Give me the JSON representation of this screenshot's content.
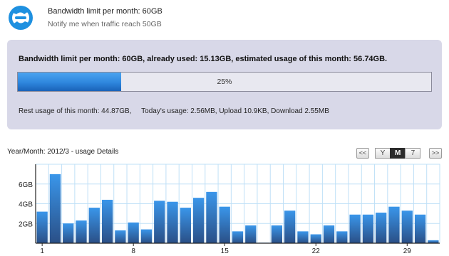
{
  "header": {
    "title": "Bandwidth limit per month: 60GB",
    "subtitle": "Notify me when traffic reach 50GB",
    "logo_icon": "swirl-logo-icon"
  },
  "usage": {
    "summary": "Bandwidth limit per month: 60GB, already used: 15.13GB, estimated usage of this month: 56.74GB.",
    "progress_label": "25%",
    "progress_fraction": 0.25,
    "rest_text": "Rest usage of this month: 44.87GB,     Today's usage: 2.56MB, Upload 10.9KB, Download 2.55MB"
  },
  "details": {
    "label": "Year/Month: 2012/3 - usage Details",
    "prev_label": "<<",
    "next_label": ">>",
    "views": [
      {
        "label": "Y",
        "active": false
      },
      {
        "label": "M",
        "active": true
      },
      {
        "label": "7",
        "active": false
      }
    ]
  },
  "colors": {
    "bar_top": "#3a96ea",
    "bar_bottom": "#2a4f86",
    "grid": "#bfe0f7",
    "axis": "#222222"
  },
  "chart_data": {
    "type": "bar",
    "x": [
      1,
      2,
      3,
      4,
      5,
      6,
      7,
      8,
      9,
      10,
      11,
      12,
      13,
      14,
      15,
      16,
      17,
      18,
      19,
      20,
      21,
      22,
      23,
      24,
      25,
      26,
      27,
      28,
      29,
      30,
      31
    ],
    "values": [
      3.2,
      7.0,
      2.0,
      2.3,
      3.6,
      4.4,
      1.3,
      2.1,
      1.4,
      4.3,
      4.2,
      3.6,
      4.6,
      5.2,
      3.7,
      1.2,
      1.8,
      0.05,
      1.8,
      3.3,
      1.2,
      0.9,
      1.8,
      1.2,
      2.9,
      2.9,
      3.1,
      3.7,
      3.3,
      2.9,
      0.3
    ],
    "x_tick_labels": [
      "1",
      "8",
      "15",
      "22",
      "29"
    ],
    "x_tick_values": [
      1,
      8,
      15,
      22,
      29
    ],
    "y_tick_labels": [
      "2GB",
      "4GB",
      "6GB"
    ],
    "y_tick_values": [
      2,
      4,
      6
    ],
    "ylim": [
      0,
      8
    ],
    "grid": true,
    "xlabel": "",
    "ylabel": "",
    "title": ""
  }
}
